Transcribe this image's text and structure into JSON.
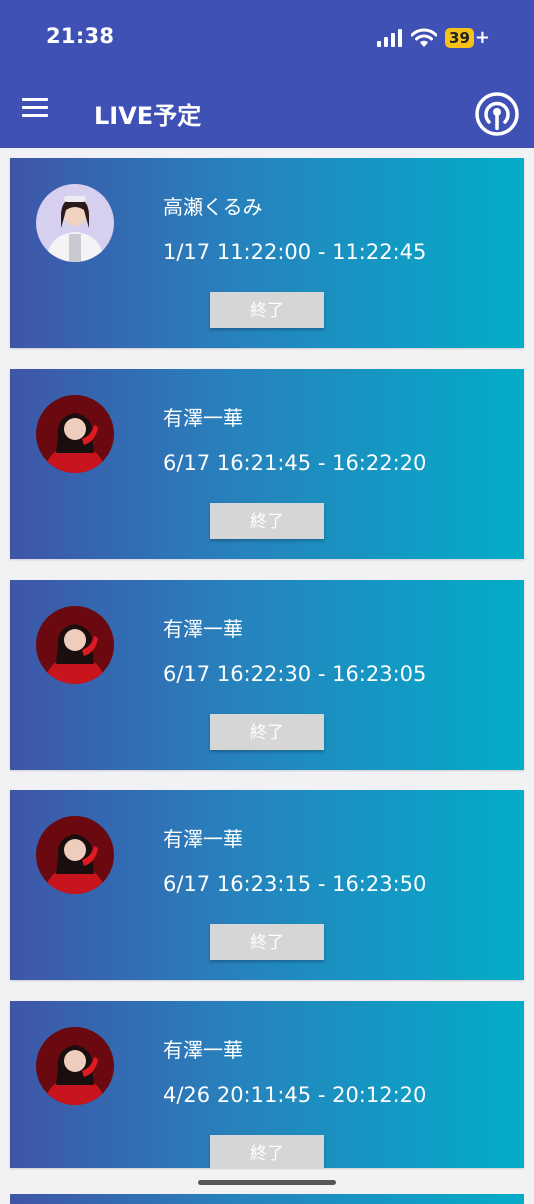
{
  "status_bar": {
    "time": "21:38",
    "battery": "39",
    "battery_suffix": "+"
  },
  "app_bar": {
    "title": "LIVE予定",
    "menu_icon": "hamburger-menu-icon",
    "action_icon": "broadcast-icon"
  },
  "colors": {
    "app_bar": "#3f51b5",
    "card_gradient_start": "#3f55a8",
    "card_gradient_end": "#03acc9",
    "end_button": "#d6d6d6"
  },
  "schedule": [
    {
      "name": "高瀬くるみ",
      "time": "1/17 11:22:00 - 11:22:45",
      "button": "終了"
    },
    {
      "name": "有澤一華",
      "time": "6/17 16:21:45 - 16:22:20",
      "button": "終了"
    },
    {
      "name": "有澤一華",
      "time": "6/17 16:22:30 - 16:23:05",
      "button": "終了"
    },
    {
      "name": "有澤一華",
      "time": "6/17 16:23:15 - 16:23:50",
      "button": "終了"
    },
    {
      "name": "有澤一華",
      "time": "4/26 20:11:45 - 20:12:20",
      "button": "終了"
    }
  ]
}
